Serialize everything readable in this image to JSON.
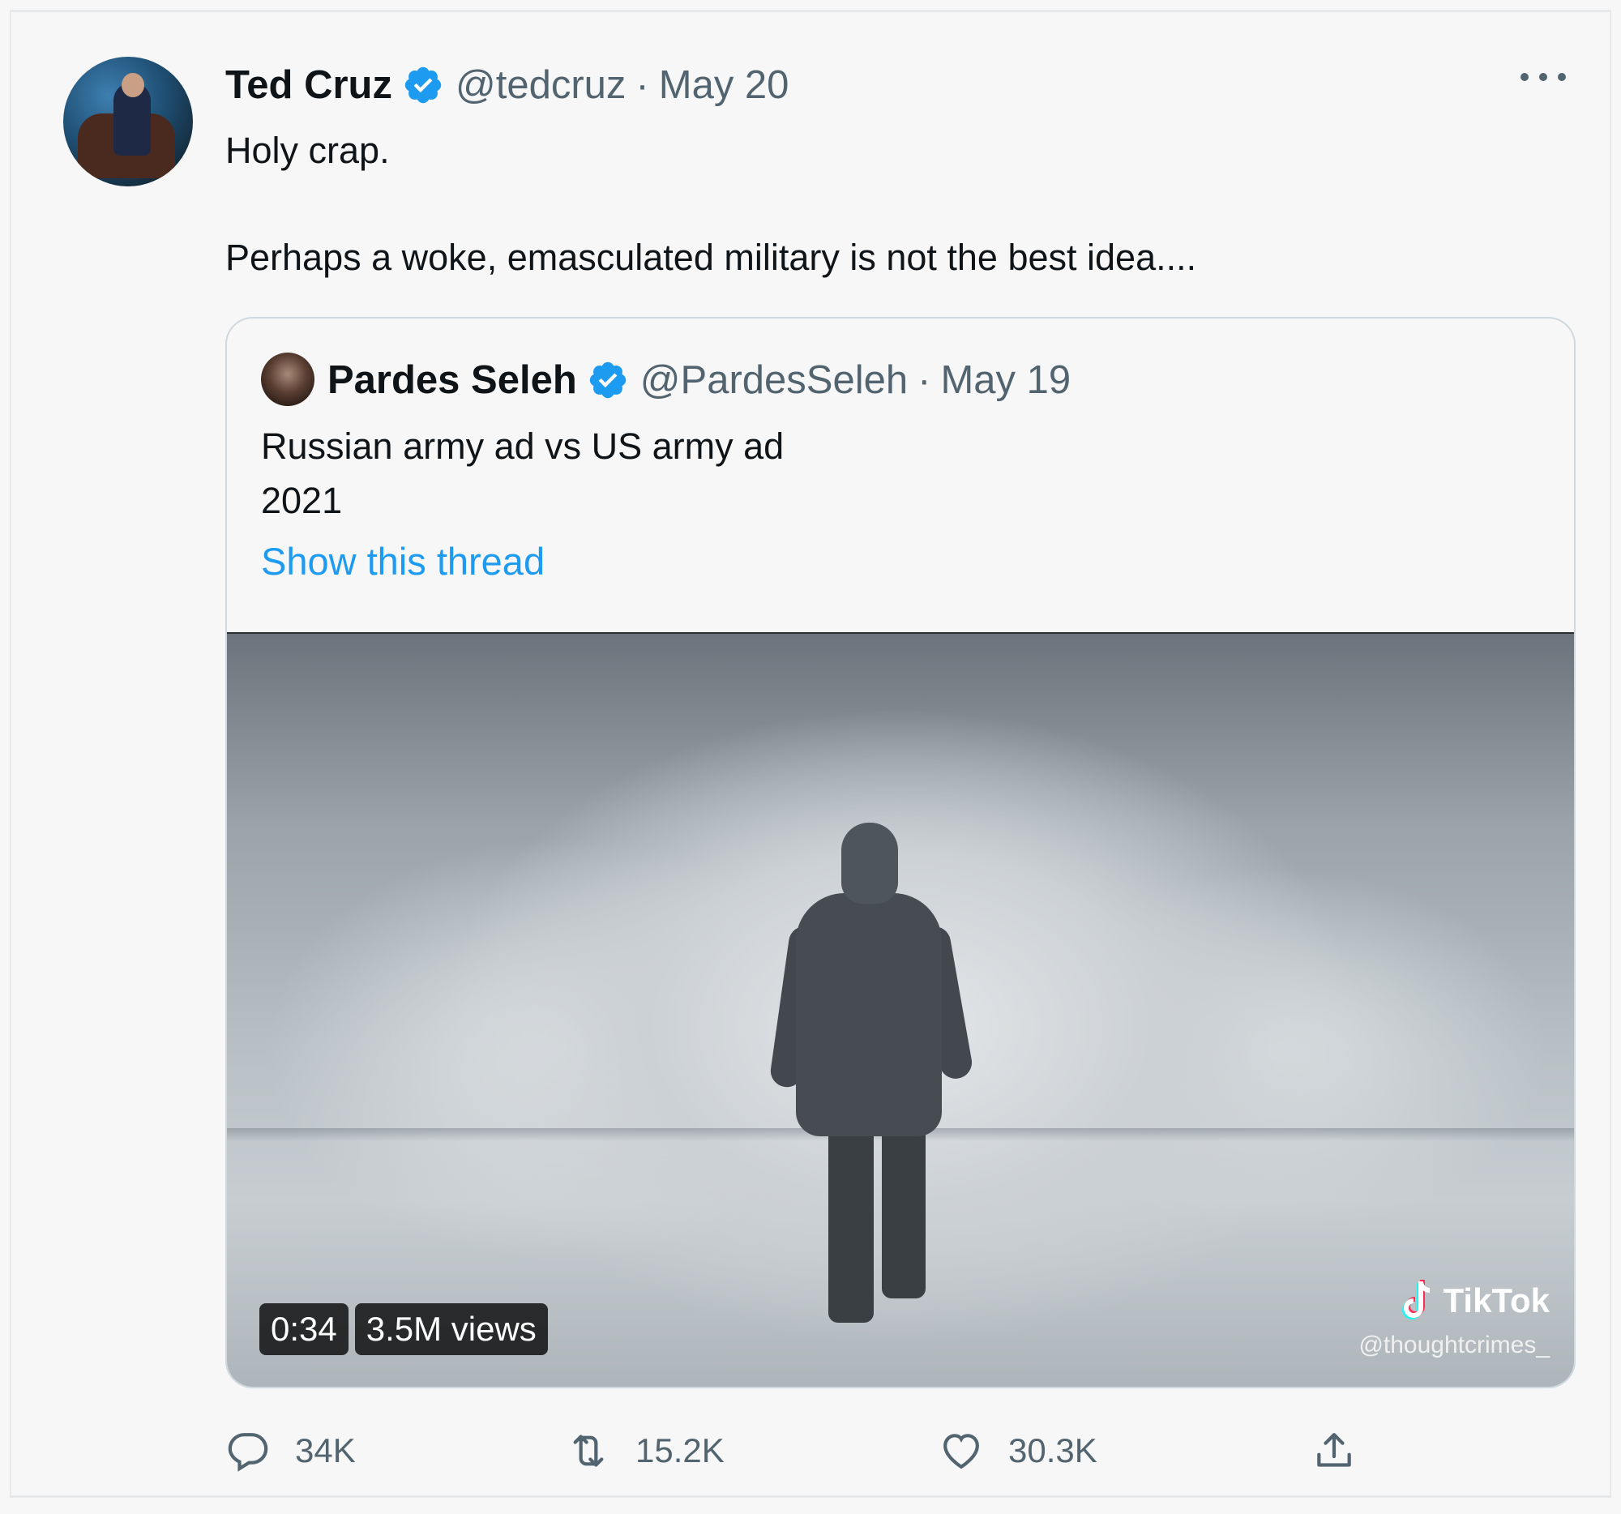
{
  "tweet": {
    "author_name": "Ted Cruz",
    "handle": "@tedcruz",
    "separator": "·",
    "date": "May 20",
    "text_line1": "Holy crap.",
    "text_line2": "Perhaps a woke, emasculated military is not the best idea...."
  },
  "quoted": {
    "author_name": "Pardes Seleh",
    "handle": "@PardesSeleh",
    "separator": "·",
    "date": "May 19",
    "text_line1": "Russian army ad vs US army ad",
    "text_line2": "2021",
    "thread_link": "Show this thread",
    "video": {
      "duration": "0:34",
      "views": "3.5M views",
      "watermark_brand": "TikTok",
      "watermark_handle": "@thoughtcrimes_"
    }
  },
  "actions": {
    "replies": "34K",
    "retweets": "15.2K",
    "likes": "30.3K"
  },
  "colors": {
    "verified": "#1d9bf0",
    "link": "#1d9bf0",
    "muted": "#536471"
  }
}
